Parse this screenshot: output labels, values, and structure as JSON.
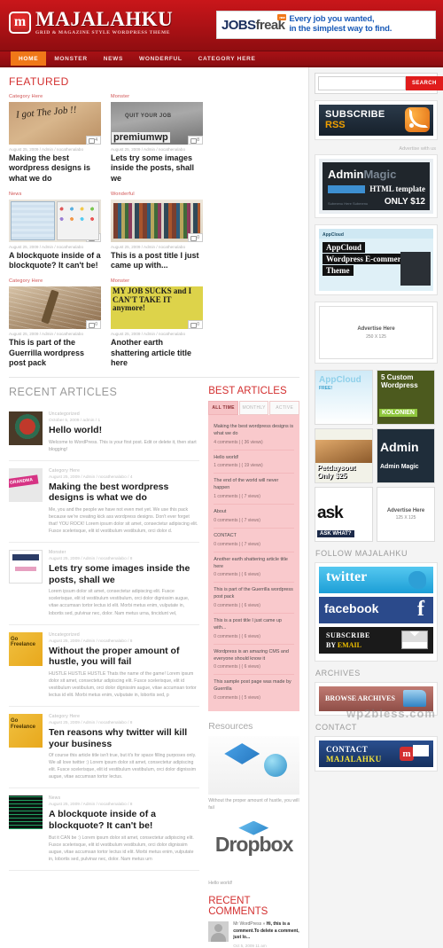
{
  "site": {
    "logo_letter": "m",
    "title": "MAJALAHKU",
    "tagline": "GRID & MAGAZINE STYLE WORDPRESS THEME"
  },
  "banner": {
    "logo_main": "JOBS",
    "logo_alt": "freak",
    "logo_badge": "new",
    "line1": "Every job you wanted,",
    "line2": "in the simplest way to find."
  },
  "nav": {
    "items": [
      {
        "label": "HOME",
        "active": true
      },
      {
        "label": "MONSTER",
        "active": false
      },
      {
        "label": "NEWS",
        "active": false
      },
      {
        "label": "WONDERFUL",
        "active": false
      },
      {
        "label": "CATEGORY HERE",
        "active": false
      }
    ]
  },
  "featured": {
    "heading": "FEATURED",
    "cards": [
      {
        "category": "Category Here",
        "meta": "August 25, 2009 / Admin / nocathenalabo",
        "comments": "4",
        "title": "Making the best wordpress designs is what we do",
        "art": "t1"
      },
      {
        "category": "Monster",
        "meta": "August 25, 2009 / Admin / nocathenalabo",
        "comments": "8",
        "title": "Lets try some images inside the posts, shall we",
        "art": "t2"
      },
      {
        "category": "News",
        "meta": "August 25, 2009 / Admin / nocathenalabo",
        "comments": "0",
        "title": "A blockquote inside of a blockquote? It can't be!",
        "art": "t3"
      },
      {
        "category": "Wonderful",
        "meta": "August 25, 2009 / Admin / nocathenalabo",
        "comments": "0",
        "title": "This is a post title I just came up with...",
        "art": "t4"
      },
      {
        "category": "Category Here",
        "meta": "August 25, 2009 / Admin / nocathenalabo",
        "comments": "0",
        "title": "This is part of the Guerrilla wordpress post pack",
        "art": "t5"
      },
      {
        "category": "Monster",
        "meta": "August 25, 2009 / Admin / nocathenalabo",
        "comments": "0",
        "title": "Another earth shattering article title here",
        "art": "t6"
      }
    ]
  },
  "recent_articles": {
    "heading": "RECENT ARTICLES",
    "items": [
      {
        "category": "Uncategorized",
        "meta": "October 5, 2009 / admin / 1",
        "title": "Hello world!",
        "excerpt": "Welcome to WordPress. This is your first post. Edit or delete it, then start blogging!",
        "art": "a1"
      },
      {
        "category": "Category Here",
        "meta": "August 25, 2009 / Admin / nocathenalabo / 4",
        "title": "Making the best wordpress designs is what we do",
        "excerpt": "Me, you and the people we have not even met yet. We use this pack because we're creating kick ass wordpress designs. Don't ever forget that! YOU ROCK! Lorem ipsum dolor sit amet, consectetur adipiscing elit. Fusce scelerisque, elit id vestibulum vestibulum, orci dolor d.",
        "art": "a2"
      },
      {
        "category": "Monster",
        "meta": "August 25, 2009 / Admin / nocathenalabo / 8",
        "title": "Lets try some images inside the posts, shall we",
        "excerpt": "Lorem ipsum dolor sit amet, consectetur adipiscing elit. Fusce scelerisque, elit id vestibulum vestibulum, orci dolor dignissim augue, vitae accumsan tortor lectus id elit. Morbi metus enim, vulputate in, lobortis sed, pulvinar nec, dolor. Nam metus urna, tincidunt vel,",
        "art": "a3"
      },
      {
        "category": "Uncategorized",
        "meta": "August 25, 2009 / Admin / nocathenalabo / 8",
        "title": "Without the proper amount of hustle, you will fail",
        "excerpt": "HUSTLE HUSTLE HUSTLE Thats the name of the game! Lorem ipsum dolor sit amet, consectetur adipiscing elit. Fusce scelerisque, elit id vestibulum vestibulum, orci dolor dignissim augue, vitae accumsan tortor lectus id elit. Morbi metus enim, vulputate in, lobortis sed, p",
        "art": "a4"
      },
      {
        "category": "Category Here",
        "meta": "August 25, 2009 / Admin / nocathenalabo / 8",
        "title": "Ten reasons why twitter will kill your business",
        "excerpt": "Of course this article title isn't true, but it's for space filling purposes only. We all love twitter :) Lorem ipsum dolor sit amet, consectetur adipiscing elit. Fusce scelerisque, elit id vestibulum vestibulum, orci dolor dignissim augue, vitae accumsan tortor lectus.",
        "art": "a5"
      },
      {
        "category": "News",
        "meta": "August 25, 2009 / Admin / nocathenalabo / 8",
        "title": "A blockquote inside of a blockquote? It can't be!",
        "excerpt": "But it CAN be :) Lorem ipsum dolor sit amet, consectetur adipiscing elit. Fusce scelerisque, elit id vestibulum vestibulum, orci dolor dignissim augue, vitae accumsan tortor lectus id elit. Morbi metus enim, vulputate in, lobortis sed, pulvinar nec, dolor. Nam metus urn",
        "art": "a6"
      }
    ]
  },
  "best_articles": {
    "heading": "BEST ARTICLES",
    "tabs": [
      {
        "label": "ALL TIME",
        "active": true
      },
      {
        "label": "MONTHLY",
        "active": false
      },
      {
        "label": "ACTIVE",
        "active": false
      }
    ],
    "items": [
      {
        "title": "Making the best wordpress designs is what we do",
        "meta": "4 comments | ( 36 views)"
      },
      {
        "title": "Hello world!",
        "meta": "1 comments | ( 19 views)"
      },
      {
        "title": "The end of the world will never happen",
        "meta": "1 comments | ( 7 views)"
      },
      {
        "title": "About",
        "meta": "0 comments | ( 7 views)"
      },
      {
        "title": "CONTACT",
        "meta": "0 comments | ( 7 views)"
      },
      {
        "title": "Another earth shattering article title here",
        "meta": "0 comments | ( 6 views)"
      },
      {
        "title": "This is part of the Guerrilla wordpress post pack",
        "meta": "0 comments | ( 6 views)"
      },
      {
        "title": "This is a post title I just came up with...",
        "meta": "0 comments | ( 6 views)"
      },
      {
        "title": "Wordpress is an amazing CMS and everyone should know it",
        "meta": "0 comments | ( 6 views)"
      },
      {
        "title": "This sample post page was made by Guerrilla",
        "meta": "0 comments | ( 5 views)"
      }
    ]
  },
  "resources": {
    "heading": "Resources",
    "items": [
      {
        "caption": "Without the proper amount of hustle, you will fail",
        "art": "r1"
      },
      {
        "caption": "Hello world!",
        "art": "r2",
        "logo_text": "Dropbox"
      }
    ]
  },
  "recent_comments": {
    "heading": "RECENT COMMENTS",
    "items": [
      {
        "author": "Mr WordPress",
        "separator": "»",
        "text": "Hi, this is a comment.To delete a comment, just lo...",
        "date": "Oct 5, 2009 11 am"
      }
    ]
  },
  "sidebar": {
    "search": {
      "placeholder": "",
      "value": "",
      "button_label": "SEARCH"
    },
    "rss_ad": {
      "line1": "SUBSCRIBE",
      "line2": "RSS",
      "icon": "rss-icon"
    },
    "advertise_label": "Advertise with us",
    "admin_magic_ad": {
      "title": "Admin",
      "title_alt": "Magic",
      "sub": "HTML template",
      "price": "ONLY $12",
      "submenu": "Submenu Here   Submenu"
    },
    "appcloud_ad": {
      "brand": "AppCloud",
      "brand_sub": "Agency &amp; E-commerce",
      "line1": "AppCloud",
      "line2": "Wordpress E-commerce",
      "line3": "Theme"
    },
    "advertise_box_1": {
      "title": "Advertise Here",
      "size": "250 X 125"
    },
    "ad_squares": [
      {
        "name": "appcloud-free",
        "art": "sq1"
      },
      {
        "name": "5-custom-wordpress",
        "art": "sq2"
      },
      {
        "name": "petdaysout",
        "art": "sq3"
      },
      {
        "name": "admin-magic",
        "art": "sq4"
      },
      {
        "name": "ask-what",
        "art": "sq5"
      }
    ],
    "advertise_box_2": {
      "title": "Advertise Here",
      "size": "125 X 125"
    },
    "follow": {
      "heading": "FOLLOW MAJALAHKU",
      "twitter": "twitter",
      "facebook": "facebook",
      "email_line1": "SUBSCRIBE",
      "email_line2_a": "BY ",
      "email_line2_b": "EMAIL"
    },
    "archives": {
      "heading": "ARCHIVES",
      "button": "BROWSE ARCHIVES"
    },
    "contact": {
      "heading": "CONTACT",
      "line1": "CONTACT",
      "line2": "MAJALAHKU",
      "mark": "m"
    }
  },
  "watermark": "wp2bless.com",
  "colors": {
    "brand_red": "#c9161a",
    "accent_orange": "#f07818",
    "heading_red": "#d32f2f",
    "best_pink": "#f9c9cc"
  }
}
